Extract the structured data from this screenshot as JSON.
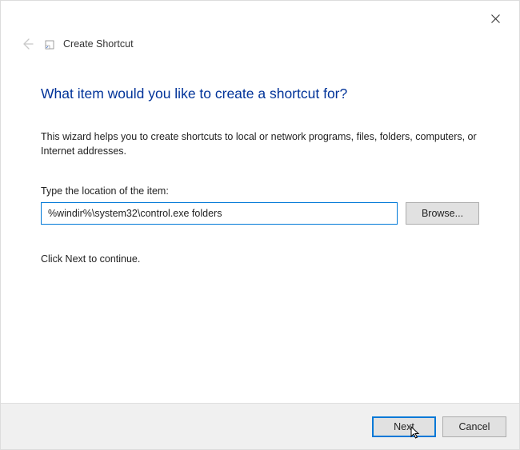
{
  "titlebar": {
    "close_label": "Close"
  },
  "header": {
    "back_label": "Back",
    "title": "Create Shortcut",
    "icon": "shortcut-wizard-icon"
  },
  "main": {
    "heading": "What item would you like to create a shortcut for?",
    "description": "This wizard helps you to create shortcuts to local or network programs, files, folders, computers, or Internet addresses.",
    "input_label": "Type the location of the item:",
    "input_value": "%windir%\\system32\\control.exe folders",
    "browse_label": "Browse...",
    "continue_text": "Click Next to continue."
  },
  "footer": {
    "next_label": "Next",
    "cancel_label": "Cancel"
  }
}
